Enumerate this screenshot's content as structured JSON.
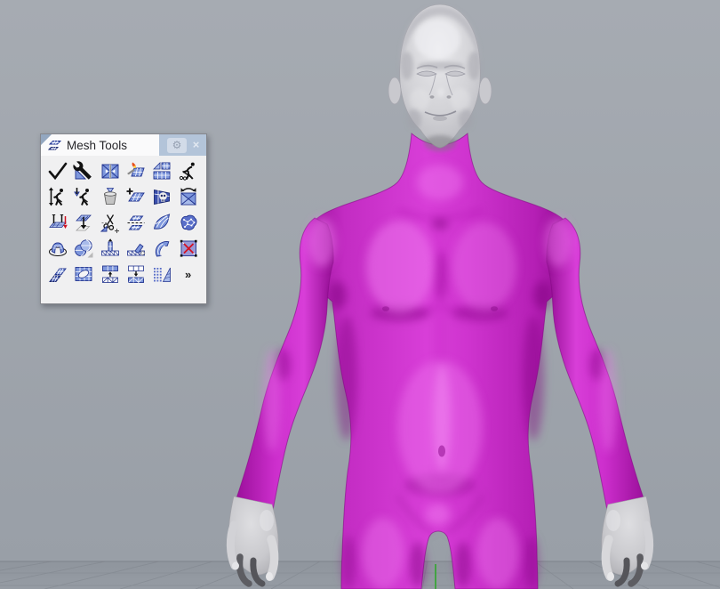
{
  "panel": {
    "title": "Mesh Tools",
    "gear_glyph": "⚙",
    "close_glyph": "×",
    "more_glyph": "»",
    "tools": [
      "check-mesh",
      "mesh-repair-wrench",
      "match-mesh-edges",
      "weld-mesh-torch",
      "fill-mesh-holes",
      "rebuild-mesh-worker",
      "adjust-mesh-worker-arrows",
      "apply-mesh-worker-down",
      "empty-mesh-bucket",
      "add-mesh-face",
      "cull-degenerate-faces-skull",
      "swap-mesh-edges",
      "align-mesh-vertices-axes",
      "drape-mesh",
      "trim-mesh-scissors",
      "split-mesh-with-plane",
      "curve-mesh-patch",
      "crumpled-mesh-patch",
      "mesh-dome-torus",
      "mesh-spheres",
      "extract-mesh-faces-up",
      "extract-mesh-faces-angled",
      "curved-mesh-ribbon",
      "mesh-frame-points",
      "offset-mesh-planes",
      "mesh-hole-ellipse",
      "collapse-mesh-faces-up",
      "collapse-mesh-faces-down",
      "points-to-mesh",
      "more-mesh-tools"
    ]
  },
  "viewport": {
    "colors": {
      "background": "#9fa5ad",
      "ground": "#939aa2",
      "grid_line": "#878d95",
      "horizon_line": "#7e838b",
      "axis_y_green": "#43a343",
      "selection_magenta": "#c826c8",
      "unselected_mesh_gray": "#d4d4d8"
    },
    "scene": {
      "model": "male human figure mesh, front view",
      "selected": "body mesh highlighted magenta (selected)",
      "unselected": "head and hands gray (unselected)"
    }
  }
}
